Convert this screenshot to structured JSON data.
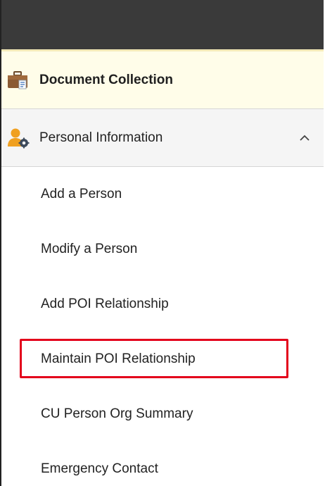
{
  "menu": {
    "document_collection": {
      "label": "Document Collection",
      "icon": "briefcase-icon"
    },
    "personal_information": {
      "label": "Personal Information",
      "icon": "person-gear-icon",
      "expanded": true,
      "toggle_icon": "chevron-up-icon",
      "items": [
        {
          "label": "Add a Person"
        },
        {
          "label": "Modify a Person"
        },
        {
          "label": "Add POI Relationship"
        },
        {
          "label": "Maintain POI Relationship",
          "highlighted": true
        },
        {
          "label": "CU Person Org Summary"
        },
        {
          "label": "Emergency Contact"
        }
      ]
    }
  },
  "colors": {
    "topbar": "#3a3a3a",
    "document_row_bg": "#fffde9",
    "section_row_bg": "#f5f5f5",
    "highlight_border": "#e3001b"
  }
}
